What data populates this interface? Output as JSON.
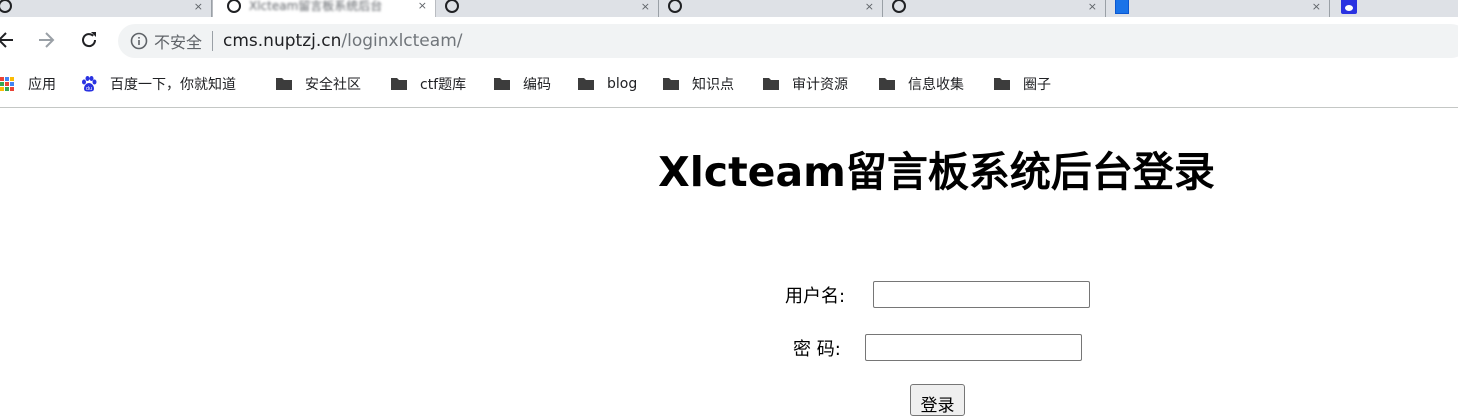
{
  "browser": {
    "tabs": [
      {
        "title": "",
        "icon": "globe-icon",
        "active": false
      },
      {
        "title": "Xlcteam留言板系统后台",
        "icon": "globe-icon",
        "active": true
      },
      {
        "title": "",
        "icon": "globe-icon",
        "active": false
      },
      {
        "title": "",
        "icon": "globe-icon",
        "active": false
      },
      {
        "title": "",
        "icon": "globe-icon",
        "active": false
      },
      {
        "title": "",
        "icon": "document-icon",
        "active": false
      },
      {
        "title": "",
        "icon": "baidu-icon",
        "active": false
      }
    ],
    "tab_close_glyph": "×",
    "security_label": "不安全",
    "url_host": "cms.nuptzj.cn",
    "url_path": "/loginxlcteam/"
  },
  "bookmarks": [
    {
      "label": "应用",
      "icon": "apps-grid-icon"
    },
    {
      "label": "百度一下，你就知道",
      "icon": "baidu-paw-icon"
    },
    {
      "label": "安全社区",
      "icon": "folder-icon"
    },
    {
      "label": "ctf题库",
      "icon": "folder-icon"
    },
    {
      "label": "编码",
      "icon": "folder-icon"
    },
    {
      "label": "blog",
      "icon": "folder-icon"
    },
    {
      "label": "知识点",
      "icon": "folder-icon"
    },
    {
      "label": "审计资源",
      "icon": "folder-icon"
    },
    {
      "label": "信息收集",
      "icon": "folder-icon"
    },
    {
      "label": "圈子",
      "icon": "folder-icon"
    }
  ],
  "page": {
    "title": "Xlcteam留言板系统后台登录",
    "form": {
      "username_label": "用户名:",
      "username_value": "",
      "password_label": "密 码:",
      "password_value": "",
      "submit_label": "登录"
    }
  },
  "colors": {
    "tab_strip": "#dee1e6",
    "omnibox": "#f1f3f4",
    "folder": "#3c3c3c",
    "baidu": "#2932e1"
  }
}
